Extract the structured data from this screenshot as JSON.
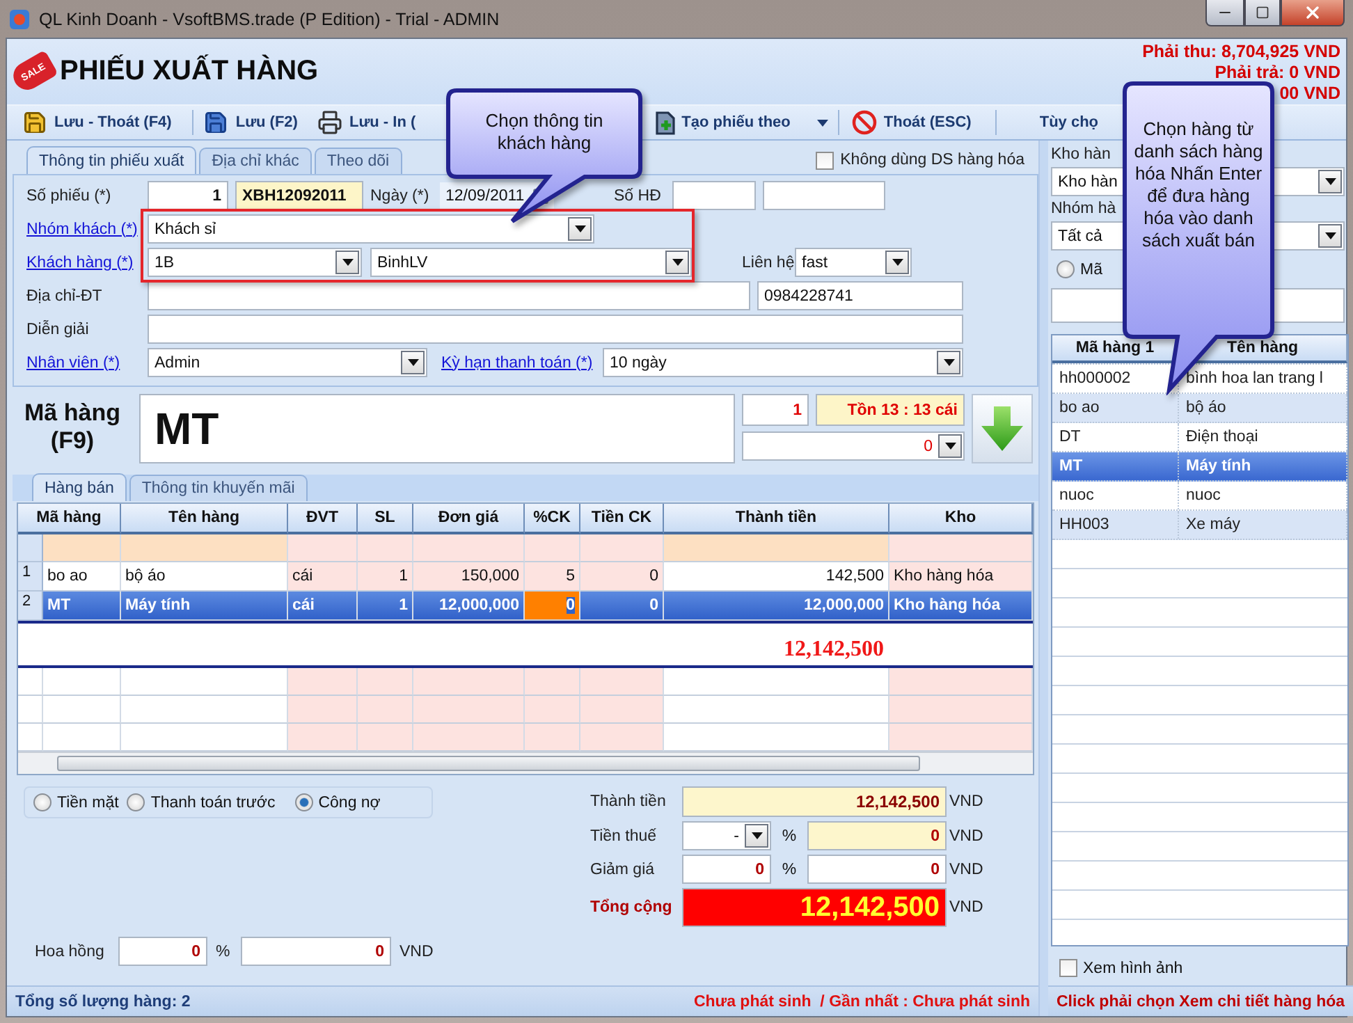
{
  "window": {
    "title": "QL Kinh Doanh - VsoftBMS.trade (P Edition) - Trial - ADMIN"
  },
  "header": {
    "logo_text": "SALE",
    "title": "PHIẾU XUẤT HÀNG",
    "balances": [
      "Phải thu: 8,704,925 VND",
      "Phải trả: 0 VND",
      "00 VND"
    ]
  },
  "toolbar": [
    {
      "kind": "save_exit",
      "label": "Lưu - Thoát (F4)"
    },
    {
      "kind": "save",
      "label": "Lưu (F2)"
    },
    {
      "kind": "print",
      "label": "Lưu - In ("
    },
    {
      "kind": "create_from",
      "label": "Tạo phiếu theo"
    },
    {
      "kind": "exit",
      "label": "Thoát (ESC)"
    },
    {
      "kind": "options",
      "label": "Tùy chọ"
    }
  ],
  "callouts": [
    "Chọn thông tin khách hàng",
    "Chọn hàng từ danh sách hàng hóa Nhấn Enter để đưa hàng hóa vào danh sách xuất bán"
  ],
  "info_tabs": [
    {
      "label": "Thông tin phiếu xuất",
      "selected": true
    },
    {
      "label": "Địa chỉ khác",
      "selected": false
    },
    {
      "label": "Theo dõi",
      "selected": false
    }
  ],
  "no_product_list": {
    "label": "Không dùng DS hàng hóa",
    "checked": false
  },
  "form": {
    "voucher_label": "Số phiếu (*)",
    "voucher_seq": "1",
    "voucher_code": "XBH12092011",
    "date_label": "Ngày (*)",
    "date": "12/09/2011",
    "invoice_label": "Số HĐ",
    "customer_group_label": "Nhóm khách (*)",
    "customer_group": "Khách sỉ",
    "customer_label": "Khách hàng (*)",
    "customer_code": "1B",
    "customer_name": "BinhLV",
    "contact_label": "Liên hệ",
    "contact": "fast",
    "address_label": "Địa chỉ-ĐT",
    "phone": "0984228741",
    "note_label": "Diễn giải",
    "staff_label": "Nhân viên (*)",
    "staff": "Admin",
    "term_label": "Kỳ hạn thanh toán (*)",
    "term": "10 ngày"
  },
  "entry": {
    "label": "Mã hàng (F9)",
    "code": "MT",
    "qty": "1",
    "stock": "Tồn 13 : 13 cái",
    "price": "0"
  },
  "grid_tabs": [
    {
      "label": "Hàng bán",
      "selected": true
    },
    {
      "label": "Thông tin khuyến mãi",
      "selected": false
    }
  ],
  "grid": {
    "columns": [
      {
        "label": "Mã hàng",
        "shaded": false
      },
      {
        "label": "Tên hàng",
        "shaded": false
      },
      {
        "label": "ĐVT",
        "shaded": true
      },
      {
        "label": "SL",
        "shaded": true
      },
      {
        "label": "Đơn giá",
        "shaded": true
      },
      {
        "label": "%CK",
        "shaded": true
      },
      {
        "label": "Tiền CK",
        "shaded": true
      },
      {
        "label": "Thành tiền",
        "shaded": false
      },
      {
        "label": "Kho",
        "shaded": true
      }
    ],
    "rows": [
      {
        "number": "1",
        "selected": false,
        "cells": [
          {
            "text": "bo ao",
            "focused": false
          },
          {
            "text": "bộ áo",
            "focused": false
          },
          {
            "text": "cái",
            "focused": false
          },
          {
            "text": "1",
            "focused": false
          },
          {
            "text": "150,000",
            "focused": false
          },
          {
            "text": "5",
            "focused": false
          },
          {
            "text": "0",
            "focused": false
          },
          {
            "text": "142,500",
            "focused": false
          },
          {
            "text": "Kho hàng hóa",
            "focused": false
          }
        ]
      },
      {
        "number": "2",
        "selected": true,
        "cells": [
          {
            "text": "MT",
            "focused": false
          },
          {
            "text": "Máy tính",
            "focused": false
          },
          {
            "text": "cái",
            "focused": false
          },
          {
            "text": "1",
            "focused": false
          },
          {
            "text": "12,000,000",
            "focused": false
          },
          {
            "text": "0",
            "focused": true
          },
          {
            "text": "0",
            "focused": false
          },
          {
            "text": "12,000,000",
            "focused": false
          },
          {
            "text": "Kho hàng hóa",
            "focused": false
          }
        ]
      }
    ],
    "total": "12,142,500"
  },
  "payment": [
    {
      "label": "Tiền mặt",
      "selected": false
    },
    {
      "label": "Thanh toán trước",
      "selected": false
    },
    {
      "label": "Công nợ",
      "selected": true
    }
  ],
  "commission": {
    "label": "Hoa hồng",
    "percent": "0",
    "percent_unit": "%",
    "amount": "0",
    "currency": "VND"
  },
  "totals": [
    {
      "kind": "subtotal",
      "label": "Thành tiền",
      "amount": "12,142,500",
      "currency": "VND"
    },
    {
      "kind": "tax",
      "label": "Tiền thuế",
      "rate": "-",
      "unit": "%",
      "amount": "0",
      "currency": "VND"
    },
    {
      "kind": "discount",
      "label": "Giảm giá",
      "rate": "0",
      "unit": "%",
      "amount": "0",
      "currency": "VND"
    },
    {
      "kind": "total",
      "label": "Tổng cộng",
      "amount": "12,142,500",
      "currency": "VND"
    }
  ],
  "status": {
    "count": "Tổng số lượng hàng: 2",
    "history": "Chưa phát sinh  / Gần nhất : Chưa phát sinh",
    "hint": "Click phải chọn Xem chi tiết hàng hóa"
  },
  "picker": {
    "warehouse_label": "Kho hàn",
    "warehouse": "Kho hàn",
    "group_label": "Nhóm hà",
    "group": "Tất cả",
    "search_by": {
      "label": "Mã",
      "selected": false
    },
    "columns": [
      "Mã hàng 1",
      "Tên hàng"
    ],
    "rows": [
      {
        "code": "hh000002",
        "name": "bình hoa lan trang l",
        "selected": false
      },
      {
        "code": "bo ao",
        "name": "bộ áo",
        "selected": false
      },
      {
        "code": "DT",
        "name": "Điện thoại",
        "selected": false
      },
      {
        "code": "MT",
        "name": "Máy tính",
        "selected": true
      },
      {
        "code": "nuoc",
        "name": "nuoc",
        "selected": false
      },
      {
        "code": "HH003",
        "name": "Xe máy",
        "selected": false
      }
    ],
    "show_images": {
      "label": "Xem hình ảnh",
      "checked": false
    }
  }
}
